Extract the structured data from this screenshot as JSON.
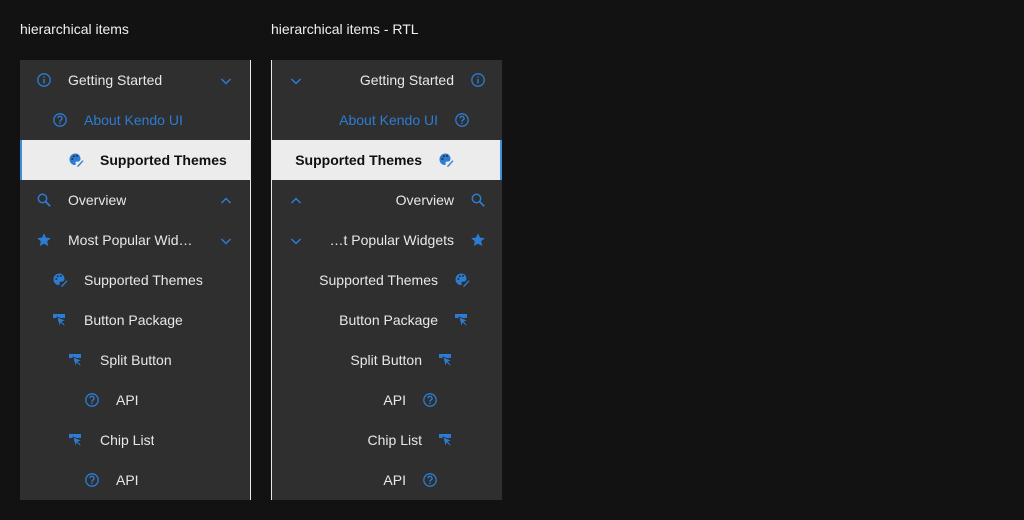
{
  "headings": {
    "ltr": "hierarchical items",
    "rtl": "hierarchical items - RTL"
  },
  "accent_color": "#2d7cd3",
  "items": [
    {
      "label": "Getting Started",
      "icon": "info-icon",
      "level": 0,
      "expander": "chevron-down"
    },
    {
      "label": "About Kendo UI",
      "icon": "help-icon",
      "level": 1,
      "state": "link"
    },
    {
      "label": "Supported Themes",
      "icon": "palette-icon",
      "level": 2,
      "state": "selected"
    },
    {
      "label": "Overview",
      "icon": "search-icon",
      "level": 0,
      "expander": "chevron-up"
    },
    {
      "label": "Most Popular Widgets",
      "icon": "star-icon",
      "level": 0,
      "expander": "chevron-down"
    },
    {
      "label": "Supported Themes",
      "icon": "palette-icon",
      "level": 1
    },
    {
      "label": "Button Package",
      "icon": "pointer-icon",
      "level": 1
    },
    {
      "label": "Split Button",
      "icon": "pointer-icon",
      "level": 2
    },
    {
      "label": "API",
      "icon": "help-icon",
      "level": 3
    },
    {
      "label": "Chip List",
      "icon": "pointer-icon",
      "level": 2
    },
    {
      "label": "API",
      "icon": "help-icon",
      "level": 3
    }
  ]
}
